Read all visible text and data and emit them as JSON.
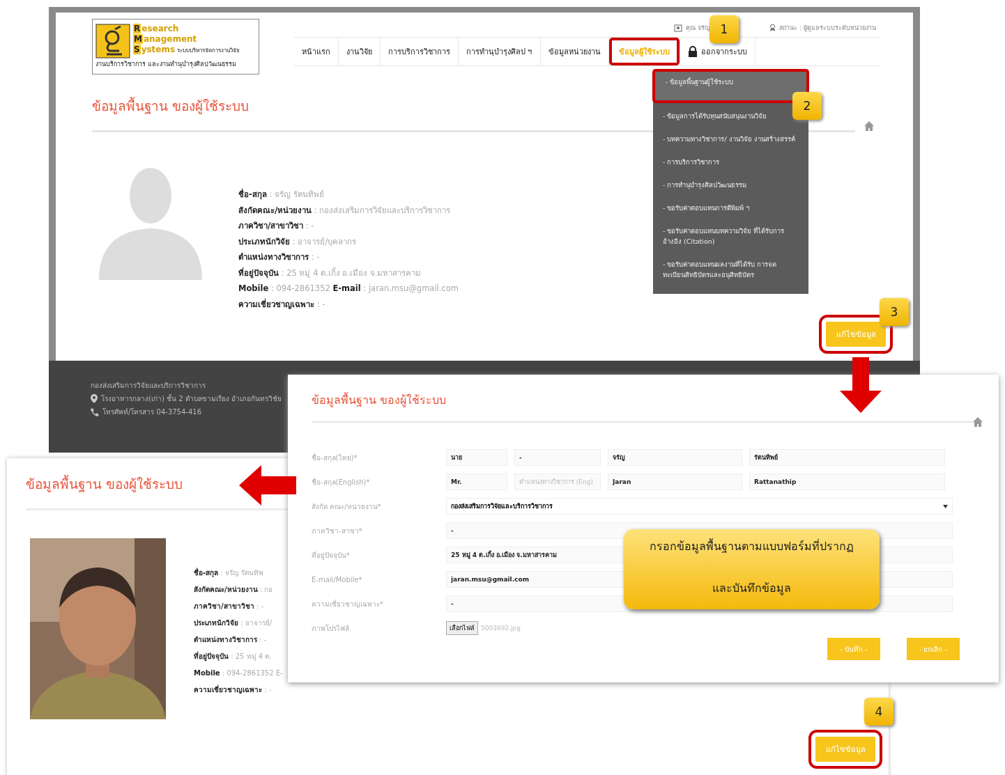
{
  "screen_top": {
    "logo": {
      "lines": [
        {
          "initial": "R",
          "rest": "esearch"
        },
        {
          "initial": "M",
          "rest": "anagement"
        },
        {
          "initial": "S",
          "rest": "ystems"
        }
      ],
      "tagline": "ระบบบริหารจัดการงานวิจัย",
      "subtitle": "งานบริการวิชาการ และงานทำนุบำรุงศิลปวัฒนธรรม"
    },
    "user": "คุณ จรัญ",
    "status": "สถานะ : ผู้ดูแลระบบระดับหน่วยงาน",
    "nav": [
      {
        "label": "หน้าแรก",
        "selected": false,
        "kind": "link"
      },
      {
        "label": "งานวิจัย",
        "selected": false,
        "kind": "link"
      },
      {
        "label": "การบริการวิชาการ",
        "selected": false,
        "kind": "link"
      },
      {
        "label": "การทำนุบำรุงศิลป ฯ",
        "selected": false,
        "kind": "link"
      },
      {
        "label": "ข้อมูลหน่วยงาน",
        "selected": false,
        "kind": "link"
      },
      {
        "label": "ข้อมูลผู้ใช้ระบบ",
        "selected": true,
        "kind": "link"
      },
      {
        "label": "ออกจากระบบ",
        "selected": false,
        "kind": "logout"
      }
    ],
    "title": "ข้อมูลพื้นฐาน ของผู้ใช้ระบบ",
    "profile": [
      {
        "parts": [
          {
            "label": "ชื่อ-สกุล",
            "value": ": จรัญ รัตนทิพย์"
          }
        ]
      },
      {
        "parts": [
          {
            "label": "สังกัดคณะ/หน่วยงาน",
            "value": ": กองส่งเสริมการวิจัยและบริการวิชาการ"
          }
        ]
      },
      {
        "parts": [
          {
            "label": "ภาควิชา/สาขาวิชา",
            "value": ": -"
          }
        ]
      },
      {
        "parts": [
          {
            "label": "ประเภทนักวิจัย",
            "value": ": อาจารย์/บุคลากร"
          }
        ]
      },
      {
        "parts": [
          {
            "label": "ตำแหน่งทางวิชาการ",
            "value": ": -"
          }
        ]
      },
      {
        "parts": [
          {
            "label": "ที่อยู่ปัจจุบัน",
            "value": ": 25 หมู่ 4 ต.เกิ้ง อ.เมือง จ.มหาสารคาม"
          }
        ]
      },
      {
        "parts": [
          {
            "label": "Mobile",
            "value": ": 094-2861352"
          },
          {
            "label": "E-mail",
            "value": ": jaran.msu@gmail.com"
          }
        ]
      },
      {
        "parts": [
          {
            "label": "ความเชี่ยวชาญเฉพาะ",
            "value": ": -"
          }
        ]
      }
    ],
    "menu": [
      {
        "label": "- ข้อมูลพื้นฐานผู้ใช้ระบบ",
        "selected": true
      },
      {
        "label": "- ข้อมูลการได้รับทุนสนับสนุนงานวิจัย",
        "selected": false
      },
      {
        "label": "- บทความทางวิชาการ/ งานวิจัย งานสร้างสรรค์",
        "selected": false
      },
      {
        "label": "- การบริการวิชาการ",
        "selected": false
      },
      {
        "label": "- การทำนุบำรุงศิลปวัฒนธรรม",
        "selected": false
      },
      {
        "label": "- ขอรับค่าตอบแทนการตีพิมพ์ ฯ",
        "selected": false
      },
      {
        "label": "- ขอรับค่าตอบแทนบทความวิจัย ที่ได้รับการอ้างอิง (Citation)",
        "selected": false
      },
      {
        "label": "- ขอรับค่าตอบแทนผลงานที่ได้รับ การจดทะเบียนสิทธิบัตรและอนุสิทธิบัตร",
        "selected": false
      }
    ],
    "edit_button": "แก้ไขข้อมูล",
    "footer": {
      "org": "กองส่งเสริมการวิจัยและบริการวิชาการ",
      "address": "โรงอาหารกลาง(เก่า) ชั้น 2 ตำบลขามเรียง อำเภอกันทรวิชัย",
      "phone": "โทรศัพท์/โทรสาร 04-3754-416"
    }
  },
  "screen_result": {
    "title": "ข้อมูลพื้นฐาน ของผู้ใช้ระบบ",
    "profile": [
      {
        "label": "ชื่อ-สกุล",
        "value": ": จรัญ รัตนทิพ"
      },
      {
        "label": "สังกัดคณะ/หน่วยงาน",
        "value": ": กอ"
      },
      {
        "label": "ภาควิชา/สาขาวิชา",
        "value": ": -"
      },
      {
        "label": "ประเภทนักวิจัย",
        "value": ": อาจารย์/"
      },
      {
        "label": "ตำแหน่งทางวิชาการ",
        "value": ": -"
      },
      {
        "label": "ที่อยู่ปัจจุบัน",
        "value": ": 25 หมู่ 4 ต."
      },
      {
        "label": "Mobile",
        "value": ": 094-2861352 E-"
      },
      {
        "label": "ความเชี่ยวชาญเฉพาะ",
        "value": ": -"
      }
    ],
    "edit_button": "แก้ไขข้อมูล"
  },
  "screen_form": {
    "title": "ข้อมูลพื้นฐาน ของผู้ใช้ระบบ",
    "fields": [
      {
        "label": "ชื่อ-สกุล(ไทย)*",
        "kind": "names",
        "inputs": [
          {
            "value": "นาย"
          },
          {
            "value": "-"
          },
          {
            "value": "จรัญ"
          },
          {
            "value": "รัตนทิพย์"
          }
        ]
      },
      {
        "label": "ชื่อ-สกุล(English)*",
        "kind": "names",
        "inputs": [
          {
            "value": "Mr."
          },
          {
            "placeholder": "ตำแหน่งทางวิชาการ (Eng)"
          },
          {
            "value": "Jaran"
          },
          {
            "value": "Rattanathip"
          }
        ]
      },
      {
        "label": "สังกัด คณะ/หน่วยงาน*",
        "kind": "select",
        "value": "กองส่งเสริมการวิจัยและบริการวิชาการ"
      },
      {
        "label": "ภาควิชา-สาขา*",
        "kind": "text",
        "value": "-"
      },
      {
        "label": "ที่อยู่ปัจจุบัน*",
        "kind": "text",
        "value": "25 หมู่ 4 ต.เกิ้ง อ.เมือง จ.มหาสารคาม"
      },
      {
        "label": "E-mail/Mobile*",
        "kind": "text",
        "value": "jaran.msu@gmail.com"
      },
      {
        "label": "ความเชี่ยวชาญเฉพาะ*",
        "kind": "text",
        "value": "-"
      },
      {
        "label": "ภาพโปรไฟล์",
        "kind": "file",
        "button": "เลือกไฟล์",
        "value": "5003692.jpg"
      }
    ],
    "buttons": [
      "- บันทึก -",
      "- ยกเลิก -"
    ]
  },
  "callouts": {
    "steps": [
      "1",
      "2",
      "3",
      "4"
    ],
    "note": [
      "กรอกข้อมูลพื้นฐานตามแบบฟอร์มที่ปรากฏ",
      "และบันทึกข้อมูล"
    ]
  }
}
